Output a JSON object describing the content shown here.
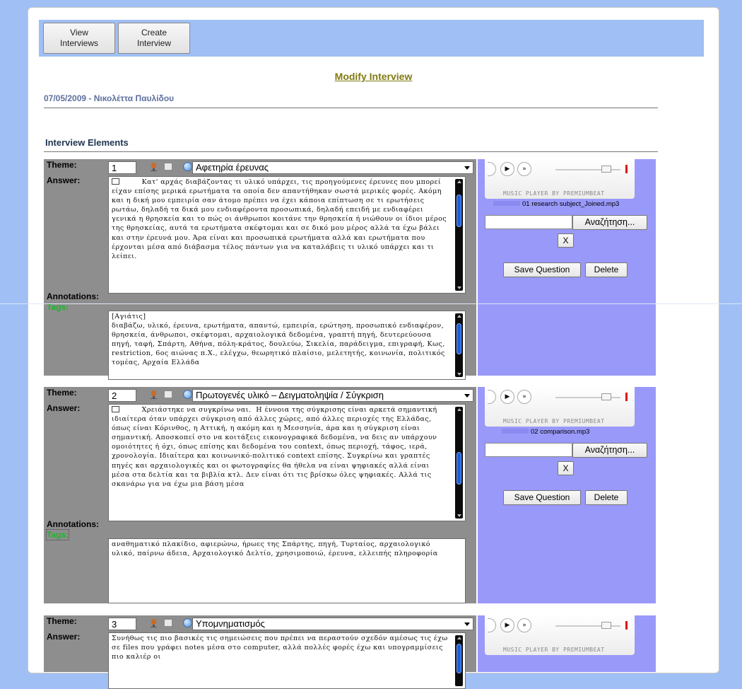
{
  "nav": {
    "view_interviews": "View\nInterviews",
    "create_interview": "Create\nInterview"
  },
  "page": {
    "title": "Modify Interview",
    "meta": "07/05/2009 - Νικολέττα Παυλίδου",
    "section": "Interview Elements"
  },
  "labels": {
    "theme": "Theme:",
    "answer": "Answer:",
    "annotations": "Annotations:",
    "tags": "Tags:",
    "browse": "Αναζήτηση...",
    "remove": "X",
    "save": "Save Question",
    "delete": "Delete",
    "player_credit": "MUSIC PLAYER BY PREMIUMBEAT"
  },
  "questions": [
    {
      "number": "1",
      "theme": "Αφετηρία έρευνας",
      "answer": "        Κατ' αρχάς διαβάζοντας τι υλικό υπάρχει, τις προηγούμενες έρευνες που μπορεί είχαν επίσης μερικά ερωτήματα τα οποία δεν απαντήθηκαν σωστά μερικές φορές. Ακόμη και η δική μου εμπειρία σαν άτομο πρέπει να έχει κάποια επίπτωση σε τι ερωτήσεις ρωτάω, δηλαδή τα δικά μου ενδιαφέροντα προσωπικά, δηλαδή επειδή με ενδιαφέρει γενικά η θρησκεία και το πώς οι άνθρωποι κοιτάνε την θρησκεία ή νιώθουν οι ίδιοι μέρος της θρησκείας, αυτά τα ερωτήματα σκέφτομαι και σε δικό μου μέρος αλλά τα έχω βάλει και στην έρευνά μου. Άρα είναι και προσωπικά ερωτήματα αλλά και ερωτήματα που έρχονται μέσα από διάβασμα τέλος πάντων για να καταλάβεις τι υλικό υπάρχει και τι λείπει.",
      "tags": "[Αγιάτις]\nδιαβάζω, υλικό, έρευνα, ερωτήματα, απαντώ, εμπειρία, ερώτηση, προσωπικό ενδιαφέρον, θρησκεία, άνθρωποι, σκέφτομαι, αρχαιολογικά δεδομένα, γραπτή πηγή, δευτερεύουσα πηγή, ταφή, Σπάρτη, Αθήνα, πόλη-κράτος, δουλεύω, Σικελία, παράδειγμα, επιγραφή, Κως, restriction, 6ος αιώνας π.Χ., ελέγχω, θεωρητικό πλαίσιο, μελετητής, κοινωνία, πολιτικός τομέας, Αρχαία Ελλάδα",
      "file": "01 research subject_Joined.mp3"
    },
    {
      "number": "2",
      "theme": "Πρωτογενές υλικό – Δειγματοληψία / Σύγκριση",
      "answer": "        Χρειάστηκε να συγκρίνω ναι.  Η έννοια της σύγκρισης είναι αρκετά σημαντική ιδιαίτερα όταν υπάρχει σύγκριση από άλλες χώρες, από άλλες περιοχές της Ελλάδας, όπως είναι Κόρινθος, η Αττική, η ακόμη και η Μεσσηνία, άρα και η σύγκριση είναι σημαντική. Αποσκοπεί στο να κοιτάξεις εικονογραφικά δεδομένα, να δεις αν υπάρχουν ομοιότητες ή όχι, όπως επίσης και δεδομένα του context, όπως περιοχή, τάφος, ιερά, χρονολογία. Ιδιαίτερα και κοινωνικό-πολιτικό context επίσης. Συγκρίνω και γραπτές πηγές και αρχαιολογικές και οι φωτογραφίες θα ήθελα να είναι ψηφιακές αλλά είναι μέσα στα δελτία και τα βιβλία κτλ. Δεν είναι ότι τις βρίσκω όλες ψηφιακές. Αλλά τις σκανάρω για να έχω μια βάση μέσα",
      "tags": "αναθηματικό πλακίδιο, αφιερώνω, ήρωες της Σπάρτης, πηγή, Τυρταίος, αρχαιολογικό υλικό, παίρνω άδεια, Αρχαιολογικό Δελτίο, χρησιμοποιώ, έρευνα, ελλειπής πληροφορία",
      "file": "02 comparison.mp3"
    },
    {
      "number": "3",
      "theme": "Υπομνηματισμός",
      "answer": "Συνήθως τις πιο βασικές τις σημειώσεις που πρέπει να περαστούν σχεδόν αμέσως τις έχω σε files που γράφει notes μέσα στο computer, αλλά πολλές φορές έχω και υπογραμμίσεις πιο καλιέρ οι"
    }
  ]
}
